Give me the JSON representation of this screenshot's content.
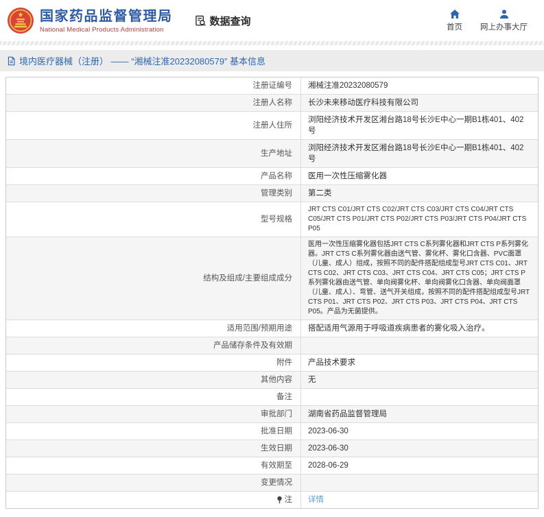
{
  "header": {
    "title_cn": "国家药品监督管理局",
    "title_en": "National Medical Products Administration",
    "section_label": "数据查询",
    "nav": [
      {
        "label": "首页",
        "icon": "home-icon"
      },
      {
        "label": "网上办事大厅",
        "icon": "user-icon"
      }
    ]
  },
  "breadcrumb": {
    "text": "境内医疗器械（注册） —— “湘械注准20232080579” 基本信息"
  },
  "table": {
    "rows": [
      {
        "label": "注册证编号",
        "value": "湘械注准20232080579"
      },
      {
        "label": "注册人名称",
        "value": "长沙未来移动医疗科技有限公司"
      },
      {
        "label": "注册人住所",
        "value": "浏阳经济技术开发区湘台路18号长沙E中心一期B1栋401、402号"
      },
      {
        "label": "生产地址",
        "value": "浏阳经济技术开发区湘台路18号长沙E中心一期B1栋401、402号"
      },
      {
        "label": "产品名称",
        "value": "医用一次性压缩雾化器"
      },
      {
        "label": "管理类别",
        "value": "第二类"
      },
      {
        "label": "型号规格",
        "value": "JRT CTS C01/JRT CTS C02/JRT CTS C03/JRT CTS C04/JRT CTS C05/JRT CTS P01/JRT CTS P02/JRT CTS P03/JRT CTS P04/JRT CTS P05"
      },
      {
        "label": "结构及组成/主要组成成分",
        "value": "医用一次性压缩雾化器包括JRT CTS C系列雾化器和JRT CTS P系列雾化器。JRT CTS C系列雾化器由送气管、雾化杯、雾化口含器、PVC面罩（儿童、成人）组成，按照不同的配件搭配组成型号JRT CTS C01、JRT CTS C02、JRT CTS C03、JRT CTS C04、JRT CTS C05；JRT CTS P系列雾化器由送气管、单向阀雾化杯、单向阀雾化口含器、单向阀面罩（儿童、成人）、弯管、送气开关组成，按照不同的配件搭配组成型号JRT CTS P01、JRT CTS P02、JRT CTS P03、JRT CTS P04、JRT CTS P05。产品为无菌提供。"
      },
      {
        "label": "适用范围/预期用途",
        "value": "搭配适用气源用于呼吸道疾病患者的雾化吸入治疗。"
      },
      {
        "label": "产品储存条件及有效期",
        "value": ""
      },
      {
        "label": "附件",
        "value": "产品技术要求"
      },
      {
        "label": "其他内容",
        "value": "无"
      },
      {
        "label": "备注",
        "value": ""
      },
      {
        "label": "审批部门",
        "value": "湖南省药品监督管理局"
      },
      {
        "label": "批准日期",
        "value": "2023-06-30"
      },
      {
        "label": "生效日期",
        "value": "2023-06-30"
      },
      {
        "label": "有效期至",
        "value": "2028-06-29"
      },
      {
        "label": "变更情况",
        "value": ""
      },
      {
        "label": "注",
        "label_icon": "note-pin-icon",
        "value": "详情",
        "value_link": true
      }
    ]
  },
  "colors": {
    "brand_blue": "#2e5ba6",
    "brand_red": "#b0413e",
    "nav_blue": "#2d66b0",
    "breadcrumb_bg": "#ececec",
    "breadcrumb_text": "#2d66b0",
    "link_blue": "#5b9bd5",
    "row_shade": "#f5f5f5",
    "emblem_red": "#da4437",
    "emblem_gold": "#f6c54a"
  }
}
